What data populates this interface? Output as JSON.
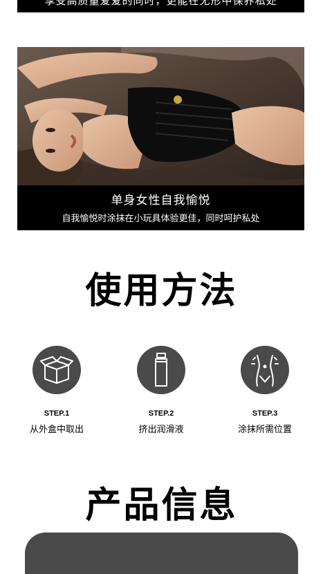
{
  "top_banner": {
    "text": "享受高质量爱爱的同时，更能在无形中保养私处"
  },
  "photo_card": {
    "title": "单身女性自我愉悦",
    "subtitle": "自我愉悦时涂抹在小玩具体验更佳，同时呵护私处"
  },
  "usage_section": {
    "title": "使用方法",
    "steps": [
      {
        "number": "STEP.1",
        "text": "从外盒中取出",
        "icon": "box-icon"
      },
      {
        "number": "STEP.2",
        "text": "挤出润滑液",
        "icon": "tube-icon"
      },
      {
        "number": "STEP.3",
        "text": "涂抹所需位置",
        "icon": "body-icon"
      }
    ]
  },
  "product_section": {
    "title": "产品信息"
  },
  "colors": {
    "dark_panel": "#000000",
    "icon_circle": "#4a4a4a",
    "text": "#000000"
  }
}
